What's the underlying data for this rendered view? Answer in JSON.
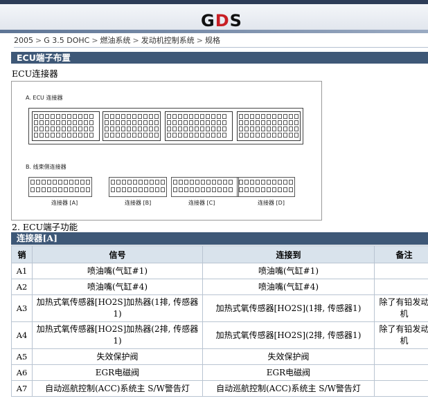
{
  "logo": "GDS",
  "breadcrumb": [
    "2005",
    "G 3.5 DOHC",
    "燃油系统",
    "发动机控制系统",
    "规格"
  ],
  "section_title": "ECU端子布置",
  "subsection": "ECU连接器",
  "diagram": {
    "caption_a": "A. ECU 连接器",
    "caption_b": "B. 线束侧连接器",
    "connectors": [
      "连接器 [A]",
      "连接器 [B]",
      "连接器 [C]",
      "连接器 [D]"
    ]
  },
  "function_label": "2. ECU端子功能",
  "connector_bar": "连接器[A]",
  "table": {
    "headers": [
      "销",
      "信号",
      "连接到",
      "备注"
    ],
    "rows": [
      {
        "pin": "A1",
        "signal": "喷油嘴(气缸#1)",
        "to": "喷油嘴(气缸#1)",
        "note": ""
      },
      {
        "pin": "A2",
        "signal": "喷油嘴(气缸#4)",
        "to": "喷油嘴(气缸#4)",
        "note": ""
      },
      {
        "pin": "A3",
        "signal": "加热式氧传感器[HO2S]加热器(1排, 传感器1)",
        "to": "加热式氧传感器[HO2S](1排, 传感器1)",
        "note": "除了有铅发动机"
      },
      {
        "pin": "A4",
        "signal": "加热式氧传感器[HO2S]加热器(2排, 传感器1)",
        "to": "加热式氧传感器[HO2S](2排, 传感器1)",
        "note": "除了有铅发动机"
      },
      {
        "pin": "A5",
        "signal": "失效保护阀",
        "to": "失效保护阀",
        "note": ""
      },
      {
        "pin": "A6",
        "signal": "EGR电磁阀",
        "to": "EGR电磁阀",
        "note": ""
      },
      {
        "pin": "A7",
        "signal": "自动巡航控制(ACC)系统主 S/W警告灯",
        "to": "自动巡航控制(ACC)系统主 S/W警告灯",
        "note": ""
      }
    ]
  }
}
